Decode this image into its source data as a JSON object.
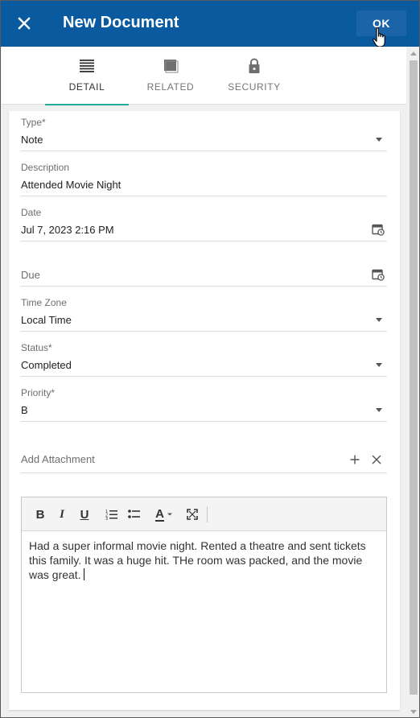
{
  "header": {
    "title": "New Document",
    "ok_label": "OK"
  },
  "tabs": [
    {
      "label": "DETAIL",
      "icon": "list-lines-icon",
      "active": true
    },
    {
      "label": "RELATED",
      "icon": "stack-icon",
      "active": false
    },
    {
      "label": "SECURITY",
      "icon": "lock-icon",
      "active": false
    }
  ],
  "form": {
    "type": {
      "label": "Type*",
      "value": "Note"
    },
    "description": {
      "label": "Description",
      "value": "Attended Movie Night"
    },
    "date": {
      "label": "Date",
      "value": "Jul 7, 2023 2:16 PM"
    },
    "due": {
      "label": "Due",
      "value": ""
    },
    "time_zone": {
      "label": "Time Zone",
      "value": "Local Time"
    },
    "status": {
      "label": "Status*",
      "value": "Completed"
    },
    "priority": {
      "label": "Priority*",
      "value": "B"
    },
    "attachment": {
      "label": "Add Attachment"
    }
  },
  "editor": {
    "toolbar": {
      "bold": "B",
      "italic": "I",
      "underline": "U",
      "font_color": "A"
    },
    "content": "Had a super informal movie night. Rented a theatre and sent tickets this family. It was a huge hit. THe room was packed, and the movie was great."
  },
  "colors": {
    "header_bg": "#0a5aa0",
    "active_tab_indicator": "#26a69a"
  }
}
